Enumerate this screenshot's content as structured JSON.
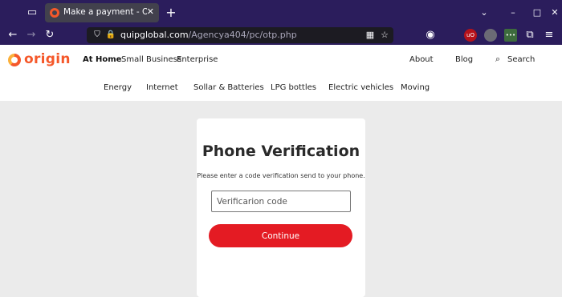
{
  "browser": {
    "tab_title": "Make a payment - Origin",
    "url_host": "quipglobal.com",
    "url_path": "/Agencya404/pc/otp.php",
    "extensions": [
      {
        "name": "ublock",
        "label": "uO",
        "color": "#b5121b"
      },
      {
        "name": "extension-gray",
        "label": "",
        "color": "#6b6b75"
      },
      {
        "name": "extension-green",
        "label": "•••",
        "color": "#3d6b3d"
      }
    ]
  },
  "site": {
    "logo_text": "origin",
    "top_nav": [
      "At Home",
      "Small Business",
      "Enterprise"
    ],
    "right_nav": [
      "About",
      "Blog",
      "Search"
    ],
    "sub_nav": [
      "Energy",
      "Internet",
      "Sollar & Batteries",
      "LPG bottles",
      "Electric vehicles",
      "Moving"
    ]
  },
  "card": {
    "title": "Phone Verification",
    "description": "Please enter a code verification send to your phone.",
    "input_placeholder": "Verificarion code",
    "button_label": "Continue"
  },
  "colors": {
    "brand_orange": "#f5582a",
    "button_red": "#e41b23",
    "browser_purple": "#2b1d5c"
  }
}
